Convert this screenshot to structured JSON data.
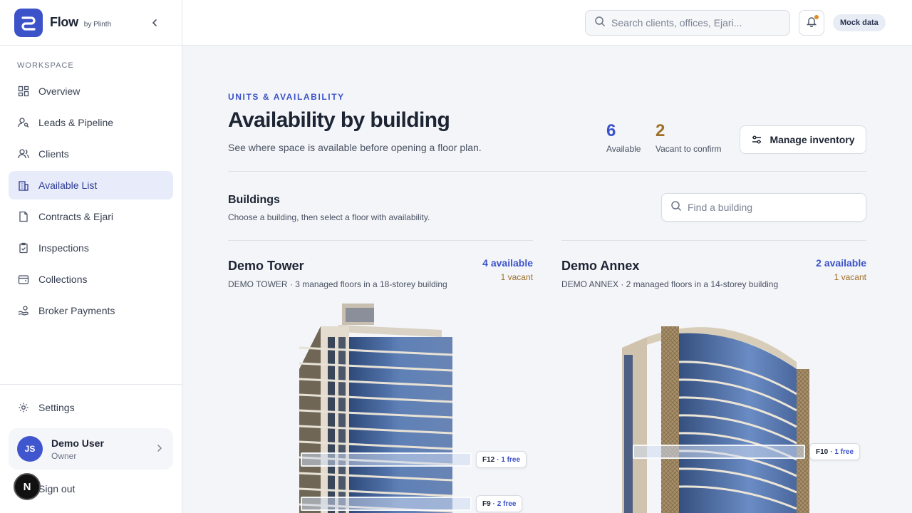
{
  "brand": {
    "name": "Flow",
    "by": "by Plinth"
  },
  "sidebar": {
    "section_label": "WORKSPACE",
    "items": [
      {
        "label": "Overview",
        "icon": "grid-icon",
        "active": false
      },
      {
        "label": "Leads & Pipeline",
        "icon": "user-search-icon",
        "active": false
      },
      {
        "label": "Clients",
        "icon": "users-icon",
        "active": false
      },
      {
        "label": "Available List",
        "icon": "building-icon",
        "active": true
      },
      {
        "label": "Contracts & Ejari",
        "icon": "document-icon",
        "active": false
      },
      {
        "label": "Inspections",
        "icon": "clipboard-check-icon",
        "active": false
      },
      {
        "label": "Collections",
        "icon": "wallet-icon",
        "active": false
      },
      {
        "label": "Broker Payments",
        "icon": "hand-coins-icon",
        "active": false
      }
    ],
    "settings_label": "Settings",
    "user": {
      "initials": "JS",
      "name": "Demo User",
      "role": "Owner"
    },
    "signout_label": "Sign out",
    "dev_badge": "N"
  },
  "topbar": {
    "search_placeholder": "Search clients, offices, Ejari...",
    "mock_label": "Mock data"
  },
  "header": {
    "eyebrow": "UNITS & AVAILABILITY",
    "title": "Availability by building",
    "subtitle": "See where space is available before opening a floor plan.",
    "stats": [
      {
        "value": "6",
        "label": "Available",
        "color": "#3b52c9"
      },
      {
        "value": "2",
        "label": "Vacant to confirm",
        "color": "#a0702a"
      }
    ],
    "manage_label": "Manage inventory"
  },
  "buildings": {
    "heading": "Buildings",
    "subheading": "Choose a building, then select a floor with availability.",
    "find_placeholder": "Find a building",
    "cards": [
      {
        "name": "Demo Tower",
        "description": "DEMO TOWER · 3 managed floors in a 18-storey building",
        "available": "4 available",
        "vacant": "1 vacant",
        "floors": [
          {
            "label": "F12",
            "free": "1 free"
          },
          {
            "label": "F9",
            "free": "2 free"
          }
        ]
      },
      {
        "name": "Demo Annex",
        "description": "DEMO ANNEX · 2 managed floors in a 14-storey building",
        "available": "2 available",
        "vacant": "1 vacant",
        "floors": [
          {
            "label": "F10",
            "free": "1 free"
          }
        ]
      }
    ]
  },
  "colors": {
    "accent": "#3b52c9",
    "warning": "#a0702a",
    "active_bg": "#e8ecfa"
  }
}
